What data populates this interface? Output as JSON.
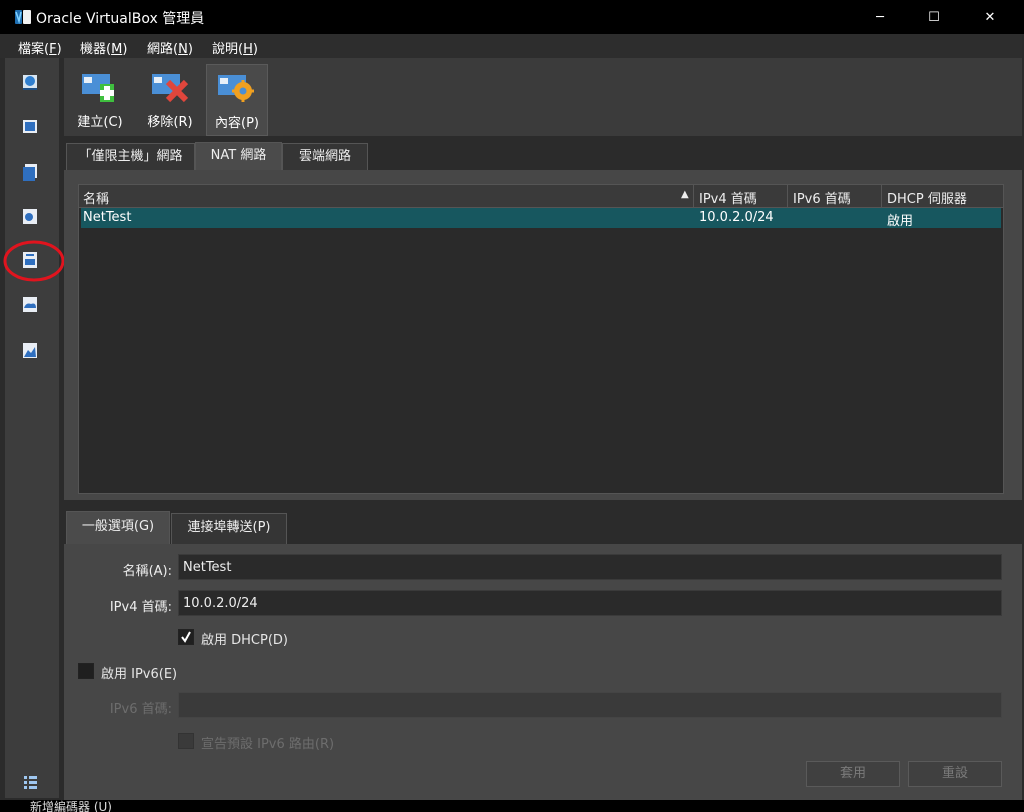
{
  "window": {
    "title": "Oracle VirtualBox 管理員",
    "minimize": "─",
    "maximize": "☐",
    "close": "✕"
  },
  "menu": [
    {
      "label": "檔案",
      "key": "F"
    },
    {
      "label": "機器",
      "key": "M"
    },
    {
      "label": "網路",
      "key": "N"
    },
    {
      "label": "說明",
      "key": "H"
    }
  ],
  "toolbar": {
    "create": "建立(C)",
    "remove": "移除(R)",
    "properties": "內容(P)"
  },
  "tabs": {
    "host_only": "「僅限主機」網路",
    "nat": "NAT 網路",
    "cloud": "雲端網路"
  },
  "table": {
    "headers": {
      "name": "名稱",
      "ipv4": "IPv4 首碼",
      "ipv6": "IPv6 首碼",
      "dhcp": "DHCP 伺服器"
    },
    "rows": [
      {
        "name": "NetTest",
        "ipv4": "10.0.2.0/24",
        "ipv6": "",
        "dhcp": "啟用"
      }
    ]
  },
  "details_tabs": {
    "general": "一般選項(G)",
    "port_forwarding": "連接埠轉送(P)"
  },
  "form": {
    "name_label": "名稱(A):",
    "name_value": "NetTest",
    "ipv4_label": "IPv4 首碼:",
    "ipv4_value": "10.0.2.0/24",
    "enable_dhcp": "啟用 DHCP(D)",
    "dhcp_checked": true,
    "enable_ipv6": "啟用 IPv6(E)",
    "ipv6_checked": false,
    "ipv6_label": "IPv6 首碼:",
    "ipv6_value": "",
    "advertise_ipv6": "宣告預設 IPv6 路由(R)"
  },
  "buttons": {
    "apply": "套用",
    "reset": "重設"
  },
  "bottom_fragment": "新增編碼器 (U)",
  "colors": {
    "selection": "#17575f",
    "annotation": "#e0141e"
  }
}
